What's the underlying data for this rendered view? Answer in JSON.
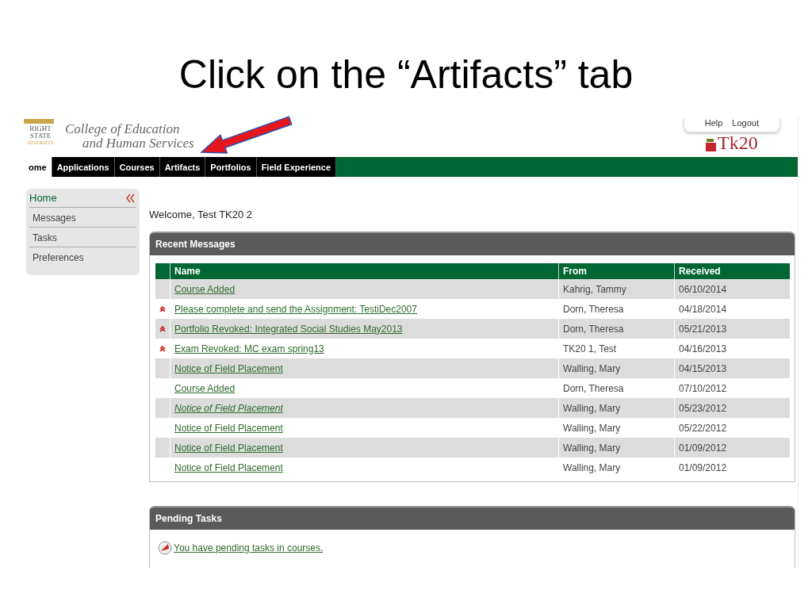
{
  "slide_title": "Click on the “Artifacts” tab",
  "header": {
    "university_logo": [
      "RIGHT",
      "STATE",
      "NIVERSITY"
    ],
    "college_name": [
      "College of Education",
      "and Human Services"
    ],
    "top_links": [
      "Help",
      "Logout"
    ],
    "product_logo": "Tk20"
  },
  "nav_tabs": [
    {
      "label": "ome",
      "selected": true
    },
    {
      "label": "Applications",
      "selected": false
    },
    {
      "label": "Courses",
      "selected": false
    },
    {
      "label": "Artifacts",
      "selected": false
    },
    {
      "label": "Portfolios",
      "selected": false
    },
    {
      "label": "Field Experience",
      "selected": false
    }
  ],
  "sidebar": {
    "title": "Home",
    "items": [
      "Messages",
      "Tasks",
      "Preferences"
    ]
  },
  "welcome": "Welcome, Test TK20 2",
  "recent_messages": {
    "title": "Recent Messages",
    "columns": [
      "Name",
      "From",
      "Received"
    ],
    "rows": [
      {
        "name": "Course Added",
        "from": "Kahrig, Tammy",
        "received": "06/10/2014",
        "flagged": false,
        "italic": false
      },
      {
        "name": "Please complete and send the Assignment: TestiDec2007",
        "from": "Dorn, Theresa",
        "received": "04/18/2014",
        "flagged": true,
        "italic": false
      },
      {
        "name": "Portfolio Revoked: Integrated Social Studies May2013",
        "from": "Dorn, Theresa",
        "received": "05/21/2013",
        "flagged": true,
        "italic": false
      },
      {
        "name": "Exam Revoked: MC exam spring13",
        "from": "TK20 1, Test",
        "received": "04/16/2013",
        "flagged": true,
        "italic": false
      },
      {
        "name": "Notice of Field Placement",
        "from": "Walling, Mary",
        "received": "04/15/2013",
        "flagged": false,
        "italic": false
      },
      {
        "name": "Course Added",
        "from": "Dorn, Theresa",
        "received": "07/10/2012",
        "flagged": false,
        "italic": false
      },
      {
        "name": "Notice of Field Placement",
        "from": "Walling, Mary",
        "received": "05/23/2012",
        "flagged": false,
        "italic": true
      },
      {
        "name": "Notice of Field Placement",
        "from": "Walling, Mary",
        "received": "05/22/2012",
        "flagged": false,
        "italic": false
      },
      {
        "name": "Notice of Field Placement",
        "from": "Walling, Mary",
        "received": "01/09/2012",
        "flagged": false,
        "italic": false
      },
      {
        "name": "Notice of Field Placement",
        "from": "Walling, Mary",
        "received": "01/09/2012",
        "flagged": false,
        "italic": false
      }
    ]
  },
  "pending_tasks": {
    "title": "Pending Tasks",
    "items": [
      "You have pending tasks in courses."
    ]
  }
}
